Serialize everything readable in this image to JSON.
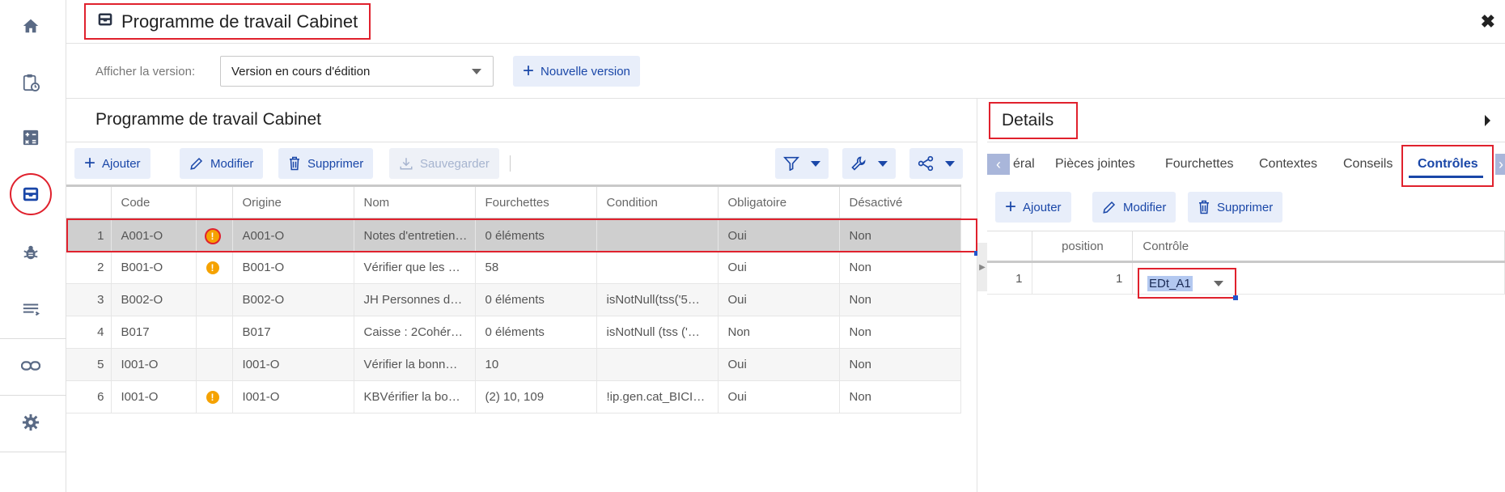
{
  "sidebar": {
    "icons": [
      "home-icon",
      "clipboard-clock-icon",
      "calculator-icon",
      "inbox-tray-icon",
      "bug-icon",
      "list-icon",
      "link-icon",
      "gear-icon"
    ],
    "active": "inbox-tray-icon"
  },
  "header": {
    "title": "Programme de travail Cabinet",
    "close": "✖"
  },
  "version": {
    "label": "Afficher la version:",
    "selected": "Version en cours d'édition",
    "new_button": "Nouvelle version"
  },
  "list": {
    "title": "Programme de travail Cabinet",
    "toolbar": {
      "add": "Ajouter",
      "edit": "Modifier",
      "delete": "Supprimer",
      "save": "Sauvegarder"
    },
    "columns": [
      "",
      "Code",
      "",
      "Origine",
      "Nom",
      "Fourchettes",
      "Condition",
      "Obligatoire",
      "Désactivé"
    ],
    "rows": [
      {
        "n": "1",
        "code": "A001-O",
        "warn": "!",
        "origine": "A001-O",
        "nom": "Notes d'entretien…",
        "fourchettes": "0 éléments",
        "condition": "",
        "obligatoire": "Oui",
        "desactive": "Non"
      },
      {
        "n": "2",
        "code": "B001-O",
        "warn": "!",
        "origine": "B001-O",
        "nom": "Vérifier que les …",
        "fourchettes": "58",
        "condition": "",
        "obligatoire": "Oui",
        "desactive": "Non"
      },
      {
        "n": "3",
        "code": "B002-O",
        "warn": "",
        "origine": "B002-O",
        "nom": "JH Personnes d…",
        "fourchettes": "0 éléments",
        "condition": "isNotNull(tss('5…",
        "obligatoire": "Oui",
        "desactive": "Non"
      },
      {
        "n": "4",
        "code": "B017",
        "warn": "",
        "origine": "B017",
        "nom": "Caisse : 2Cohér…",
        "fourchettes": "0 éléments",
        "condition": "isNotNull (tss ('…",
        "obligatoire": "Non",
        "desactive": "Non"
      },
      {
        "n": "5",
        "code": "I001-O",
        "warn": "",
        "origine": "I001-O",
        "nom": "Vérifier la bonn…",
        "fourchettes": "10",
        "condition": "",
        "obligatoire": "Oui",
        "desactive": "Non"
      },
      {
        "n": "6",
        "code": "I001-O",
        "warn": "!",
        "origine": "I001-O",
        "nom": "KBVérifier la bo…",
        "fourchettes": "(2) 10, 109",
        "condition": "!ip.gen.cat_BICI…",
        "obligatoire": "Oui",
        "desactive": "Non"
      }
    ]
  },
  "details": {
    "title": "Details",
    "tabs": [
      "éral",
      "Pièces jointes",
      "Fourchettes",
      "Contextes",
      "Conseils",
      "Contrôles"
    ],
    "active_tab": "Contrôles",
    "toolbar": {
      "add": "Ajouter",
      "edit": "Modifier",
      "delete": "Supprimer"
    },
    "columns": [
      "",
      "position",
      "Contrôle"
    ],
    "rows": [
      {
        "n": "1",
        "position": "1",
        "controle": "EDt_A1"
      }
    ]
  },
  "colors": {
    "accent": "#1a47a8",
    "highlight": "#e0212d",
    "button_bg": "#e8eefa",
    "warning": "#f5a200"
  }
}
